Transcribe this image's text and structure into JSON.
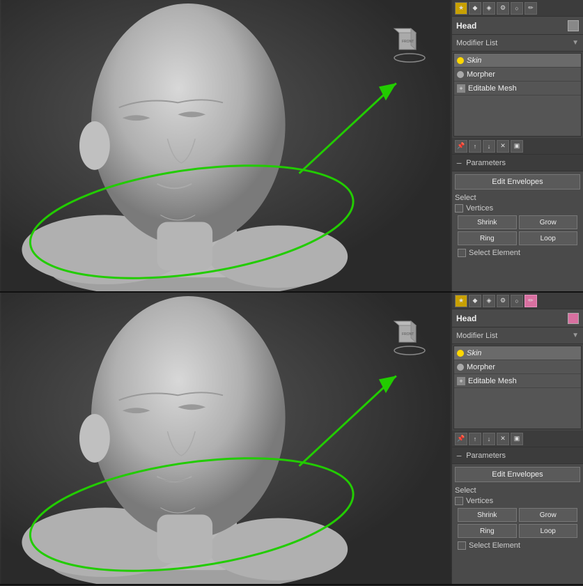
{
  "panels": [
    {
      "id": "top",
      "object_name": "Head",
      "color_swatch": "gray",
      "modifier_list_label": "Modifier List",
      "modifiers": [
        {
          "name": "Skin",
          "italic": true,
          "dot": "yellow",
          "selected": true
        },
        {
          "name": "Morpher",
          "dot": "gray",
          "selected": false
        },
        {
          "name": "Editable Mesh",
          "dot": "gray",
          "plus": true,
          "selected": false
        }
      ],
      "parameters_label": "Parameters",
      "edit_envelopes_label": "Edit Envelopes",
      "select_label": "Select",
      "vertices_label": "Vertices",
      "vertices_checked": false,
      "shrink_label": "Shrink",
      "grow_label": "Grow",
      "ring_label": "Ring",
      "loop_label": "Loop",
      "select_element_label": "Select Element",
      "select_element_checked": false
    },
    {
      "id": "bottom",
      "object_name": "Head",
      "color_swatch": "pink",
      "modifier_list_label": "Modifier List",
      "modifiers": [
        {
          "name": "Skin",
          "italic": true,
          "dot": "yellow",
          "selected": true
        },
        {
          "name": "Morpher",
          "dot": "gray",
          "selected": false
        },
        {
          "name": "Editable Mesh",
          "dot": "gray",
          "plus": true,
          "selected": false
        }
      ],
      "parameters_label": "Parameters",
      "edit_envelopes_label": "Edit Envelopes",
      "select_label": "Select",
      "vertices_label": "Vertices",
      "vertices_checked": false,
      "shrink_label": "Shrink",
      "grow_label": "Grow",
      "ring_label": "Ring",
      "loop_label": "Loop",
      "select_element_label": "Select Element",
      "select_element_checked": false
    }
  ],
  "toolbar_icons": [
    "★",
    "◆",
    "◈",
    "⚙",
    "🔵",
    "✏"
  ],
  "modifier_icons": [
    "↔",
    "↕",
    "◆",
    "⊞",
    "▣"
  ]
}
